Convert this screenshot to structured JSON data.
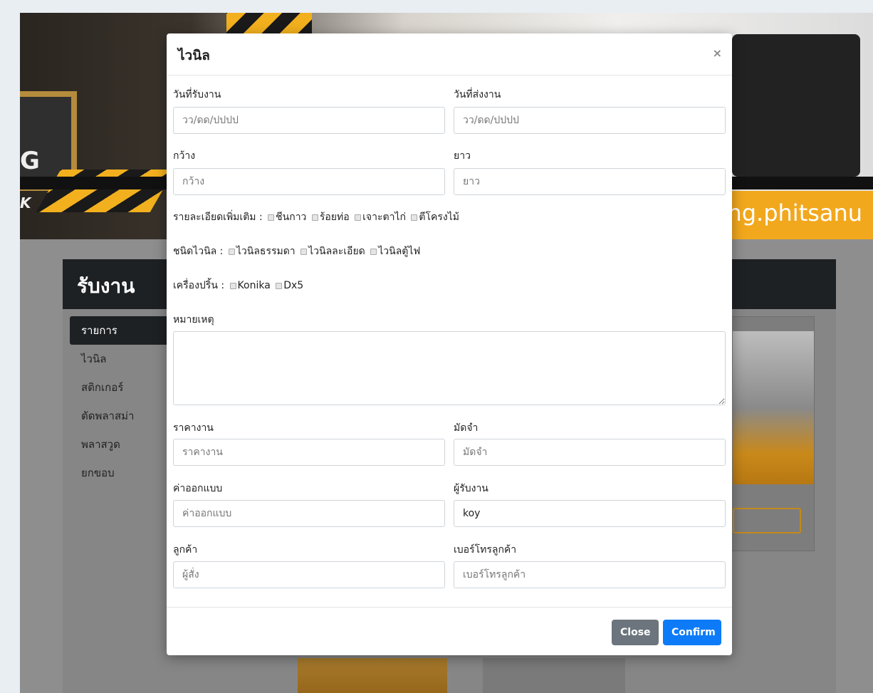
{
  "background": {
    "banner_url_text": "ting.phitsanu",
    "banner_g": "G",
    "banner_k": "K",
    "panel_title": "รับงาน",
    "sidebar": [
      {
        "label": "รายการ",
        "active": true
      },
      {
        "label": "ไวนิล",
        "active": false
      },
      {
        "label": "สติกเกอร์",
        "active": false
      },
      {
        "label": "ตัดพลาสม่า",
        "active": false
      },
      {
        "label": "พลาสวูด",
        "active": false
      },
      {
        "label": "ยกขอบ",
        "active": false
      }
    ]
  },
  "modal": {
    "title": "ไวนิล",
    "close_icon": "×",
    "fields": {
      "receive_date": {
        "label": "วันที่รับงาน",
        "placeholder": "วว/ดด/ปปปป",
        "value": ""
      },
      "send_date": {
        "label": "วันที่ส่งงาน",
        "placeholder": "วว/ดด/ปปปป",
        "value": ""
      },
      "width": {
        "label": "กว้าง",
        "placeholder": "กว้าง",
        "value": ""
      },
      "length": {
        "label": "ยาว",
        "placeholder": "ยาว",
        "value": ""
      },
      "price": {
        "label": "ราคางาน",
        "placeholder": "ราคางาน",
        "value": ""
      },
      "deposit": {
        "label": "มัดจำ",
        "placeholder": "มัดจำ",
        "value": ""
      },
      "design_fee": {
        "label": "ค่าออกแบบ",
        "placeholder": "ค่าออกแบบ",
        "value": ""
      },
      "receiver": {
        "label": "ผู้รับงาน",
        "placeholder": "",
        "value": "koy"
      },
      "customer": {
        "label": "ลูกค้า",
        "placeholder": "ผู้สั่ง",
        "value": ""
      },
      "customer_phone": {
        "label": "เบอร์โทรลูกค้า",
        "placeholder": "เบอร์โทรลูกค้า",
        "value": ""
      }
    },
    "details": {
      "label": "รายละเอียดเพิ่มเติม :",
      "options": [
        "ชีนกาว",
        "ร้อยท่อ",
        "เจาะตาไก่",
        "ตีโครงไม้"
      ]
    },
    "vinyl_type": {
      "label": "ชนิดไวนิล :",
      "options": [
        "ไวนิลธรรมดา",
        "ไวนิลละเอียด",
        "ไวนิลตู้ไฟ"
      ]
    },
    "printer": {
      "label": "เครื่องปริ้น :",
      "options": [
        "Konika",
        "Dx5"
      ]
    },
    "note_label": "หมายเหตุ",
    "buttons": {
      "close": "Close",
      "confirm": "Confirm"
    }
  },
  "colors": {
    "primary": "#0d7bf7",
    "secondary": "#6c757d",
    "accent": "#f2a81d"
  }
}
